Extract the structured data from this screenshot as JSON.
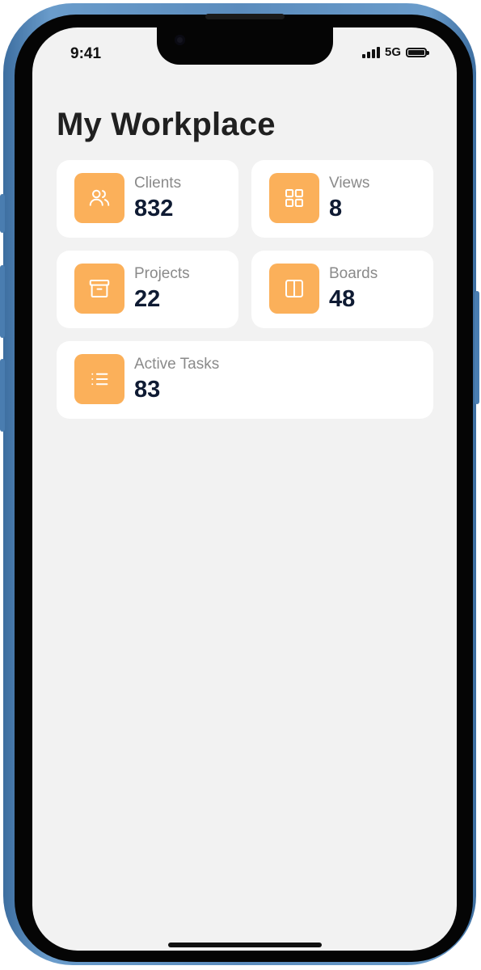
{
  "status_bar": {
    "time": "9:41",
    "network": "5G"
  },
  "page": {
    "title": "My Workplace"
  },
  "theme": {
    "accent": "#fbb05a",
    "card_bg": "#ffffff",
    "screen_bg": "#f2f2f2",
    "value_color": "#0f1b33",
    "label_color": "#8a8a8a"
  },
  "cards": [
    {
      "label": "Clients",
      "value": "832",
      "icon": "users-icon"
    },
    {
      "label": "Views",
      "value": "8",
      "icon": "grid-icon"
    },
    {
      "label": "Projects",
      "value": "22",
      "icon": "archive-icon"
    },
    {
      "label": "Boards",
      "value": "48",
      "icon": "columns-icon"
    },
    {
      "label": "Active Tasks",
      "value": "83",
      "icon": "list-icon"
    }
  ]
}
